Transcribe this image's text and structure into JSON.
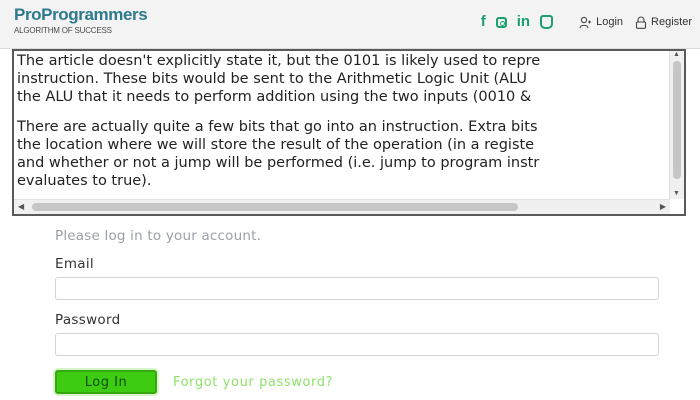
{
  "header": {
    "brand_name": "ProProgrammers",
    "brand_tagline": "ALGORITHM OF SUCCESS",
    "social_icons": [
      "facebook-icon",
      "instagram-icon",
      "linkedin-icon",
      "whatsapp-icon"
    ],
    "social_color": "#1aa06f",
    "login_label": "Login",
    "register_label": "Register"
  },
  "article": {
    "paragraphs": [
      [
        "The article doesn't explicitly state it, but the 0101 is likely used to repre",
        "instruction. These bits would be sent to the Arithmetic Logic Unit (ALU",
        "the ALU that it needs to perform addition using the two inputs (0010 &"
      ],
      [
        "There are actually quite a few bits that go into an instruction. Extra bits",
        "the location where we will store the result of the operation (in a registe",
        "and whether or not a jump will be performed (i.e. jump to program instr",
        "evaluates to true)."
      ]
    ]
  },
  "login_form": {
    "prompt": "Please log in to your account.",
    "email_label": "Email",
    "email_value": "",
    "password_label": "Password",
    "password_value": "",
    "submit_label": "Log In",
    "forgot_label": "Forgot your password?"
  },
  "colors": {
    "brand": "#2c7a8c",
    "login_button": "#3dcc12",
    "forgot_link": "#8ee26a"
  }
}
